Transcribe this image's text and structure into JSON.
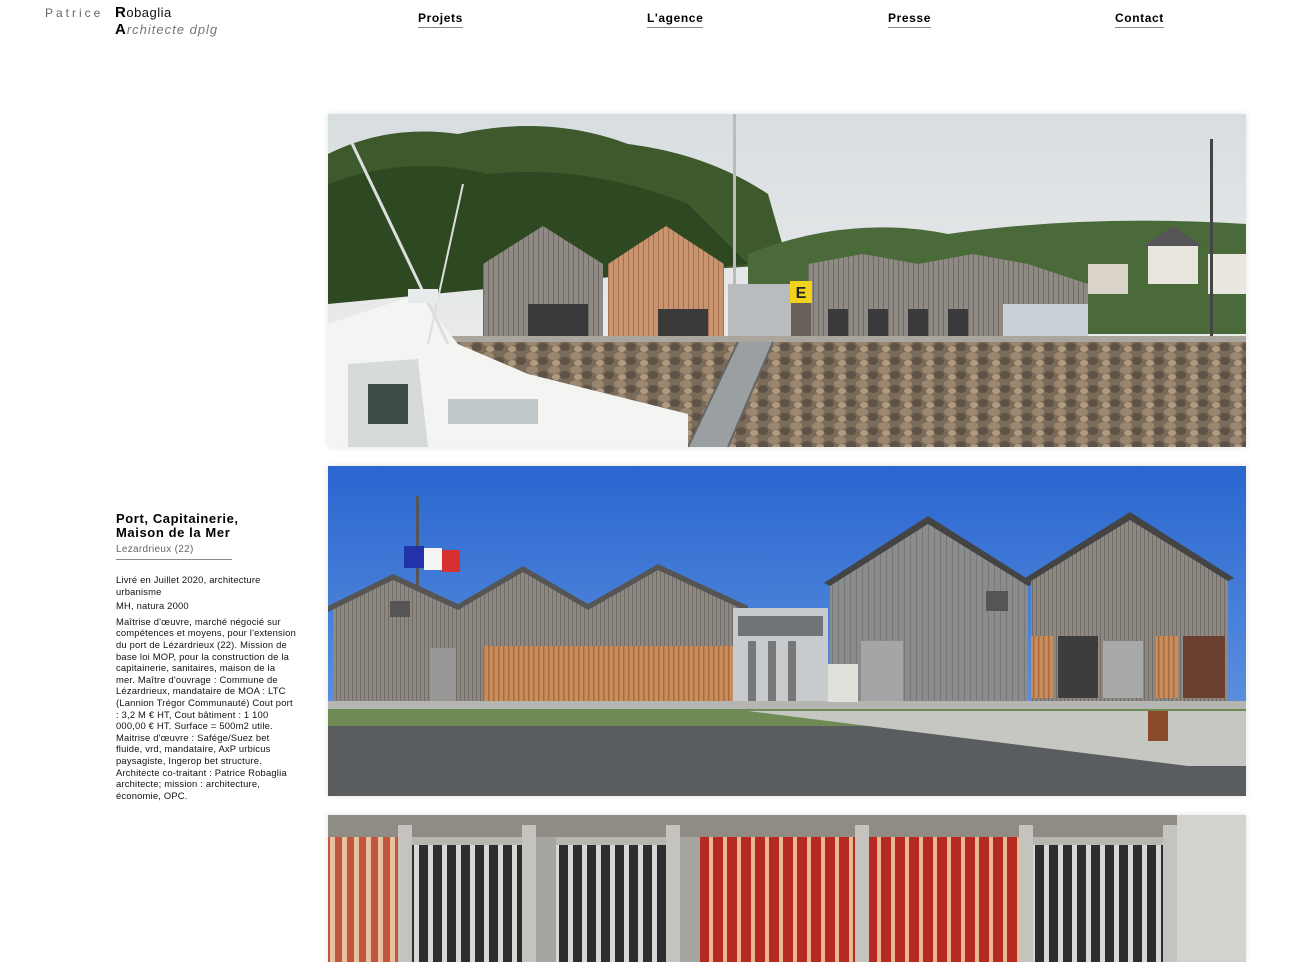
{
  "logo": {
    "first_name": "Patrice",
    "last_initial": "R",
    "last_rest": "obaglia",
    "sub_initial": "A",
    "sub_rest": "rchitecte dplg"
  },
  "nav": [
    {
      "label": "Projets"
    },
    {
      "label": "L'agence"
    },
    {
      "label": "Presse"
    },
    {
      "label": "Contact"
    }
  ],
  "project": {
    "title_line1": "Port, Capitainerie,",
    "title_line2": "Maison de la Mer",
    "location": "Lezardrieux (22)",
    "p1": "Livré en Juillet 2020, architecture urbanisme",
    "p2": "MH, natura 2000",
    "p3": "Maîtrise d'œuvre, marché négocié sur compétences et moyens, pour l'extension du port de Lézardrieux (22). Mission de base loi MOP, pour la construction de la capitainerie, sanitaires, maison de la mer. Maître d'ouvrage : Commune de Lézardrieux, mandataire de MOA : LTC (Lannion Trégor Communauté) Cout port : 3,2 M € HT, Cout bâtiment : 1 100 000,00 € HT. Surface = 500m2 utile.",
    "p4": "Maitrise d'œuvre : Safége/Suez bet fluide, vrd, mandataire, AxP urbicus paysagiste, Ingerop bet structure. Architecte co-traitant : Patrice Robaglia architecte; mission : architecture, économie, OPC."
  },
  "photo1": {
    "sign_text": "E"
  },
  "colors": {
    "sky_blue": "#2f6fd6",
    "wood_grey": "#8a8580",
    "wood_orange": "#c8885a",
    "red_louvre": "#b8332a"
  }
}
